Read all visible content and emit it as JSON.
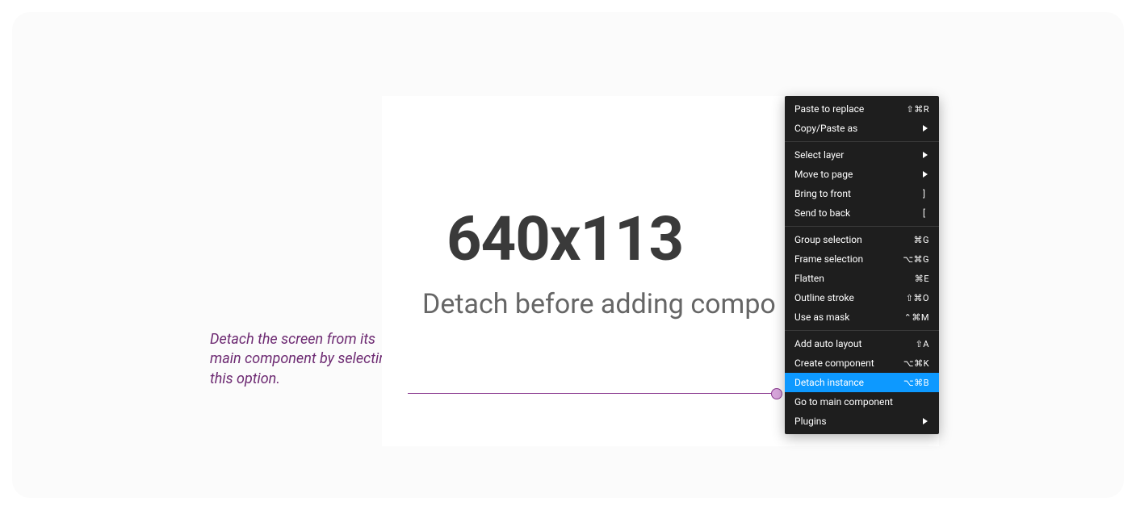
{
  "annotation": {
    "text": "Detach the screen from its main component by selecting this option."
  },
  "canvas": {
    "dimensions": "640x113",
    "subtitle": "Detach before adding compo"
  },
  "menu": {
    "groups": [
      {
        "items": [
          {
            "label": "Paste to replace",
            "shortcut": "⇧⌘R",
            "submenu": false,
            "highlight": false
          },
          {
            "label": "Copy/Paste as",
            "shortcut": "",
            "submenu": true,
            "highlight": false
          }
        ]
      },
      {
        "items": [
          {
            "label": "Select layer",
            "shortcut": "",
            "submenu": true,
            "highlight": false
          },
          {
            "label": "Move to page",
            "shortcut": "",
            "submenu": true,
            "highlight": false
          },
          {
            "label": "Bring to front",
            "shortcut": "]",
            "submenu": false,
            "highlight": false
          },
          {
            "label": "Send to back",
            "shortcut": "[",
            "submenu": false,
            "highlight": false
          }
        ]
      },
      {
        "items": [
          {
            "label": "Group selection",
            "shortcut": "⌘G",
            "submenu": false,
            "highlight": false
          },
          {
            "label": "Frame selection",
            "shortcut": "⌥⌘G",
            "submenu": false,
            "highlight": false
          },
          {
            "label": "Flatten",
            "shortcut": "⌘E",
            "submenu": false,
            "highlight": false
          },
          {
            "label": "Outline stroke",
            "shortcut": "⇧⌘O",
            "submenu": false,
            "highlight": false
          },
          {
            "label": "Use as mask",
            "shortcut": "⌃⌘M",
            "submenu": false,
            "highlight": false
          }
        ]
      },
      {
        "items": [
          {
            "label": "Add auto layout",
            "shortcut": "⇧A",
            "submenu": false,
            "highlight": false
          },
          {
            "label": "Create component",
            "shortcut": "⌥⌘K",
            "submenu": false,
            "highlight": false
          },
          {
            "label": "Detach instance",
            "shortcut": "⌥⌘B",
            "submenu": false,
            "highlight": true
          },
          {
            "label": "Go to main component",
            "shortcut": "",
            "submenu": false,
            "highlight": false
          },
          {
            "label": "Plugins",
            "shortcut": "",
            "submenu": true,
            "highlight": false
          }
        ]
      }
    ]
  }
}
